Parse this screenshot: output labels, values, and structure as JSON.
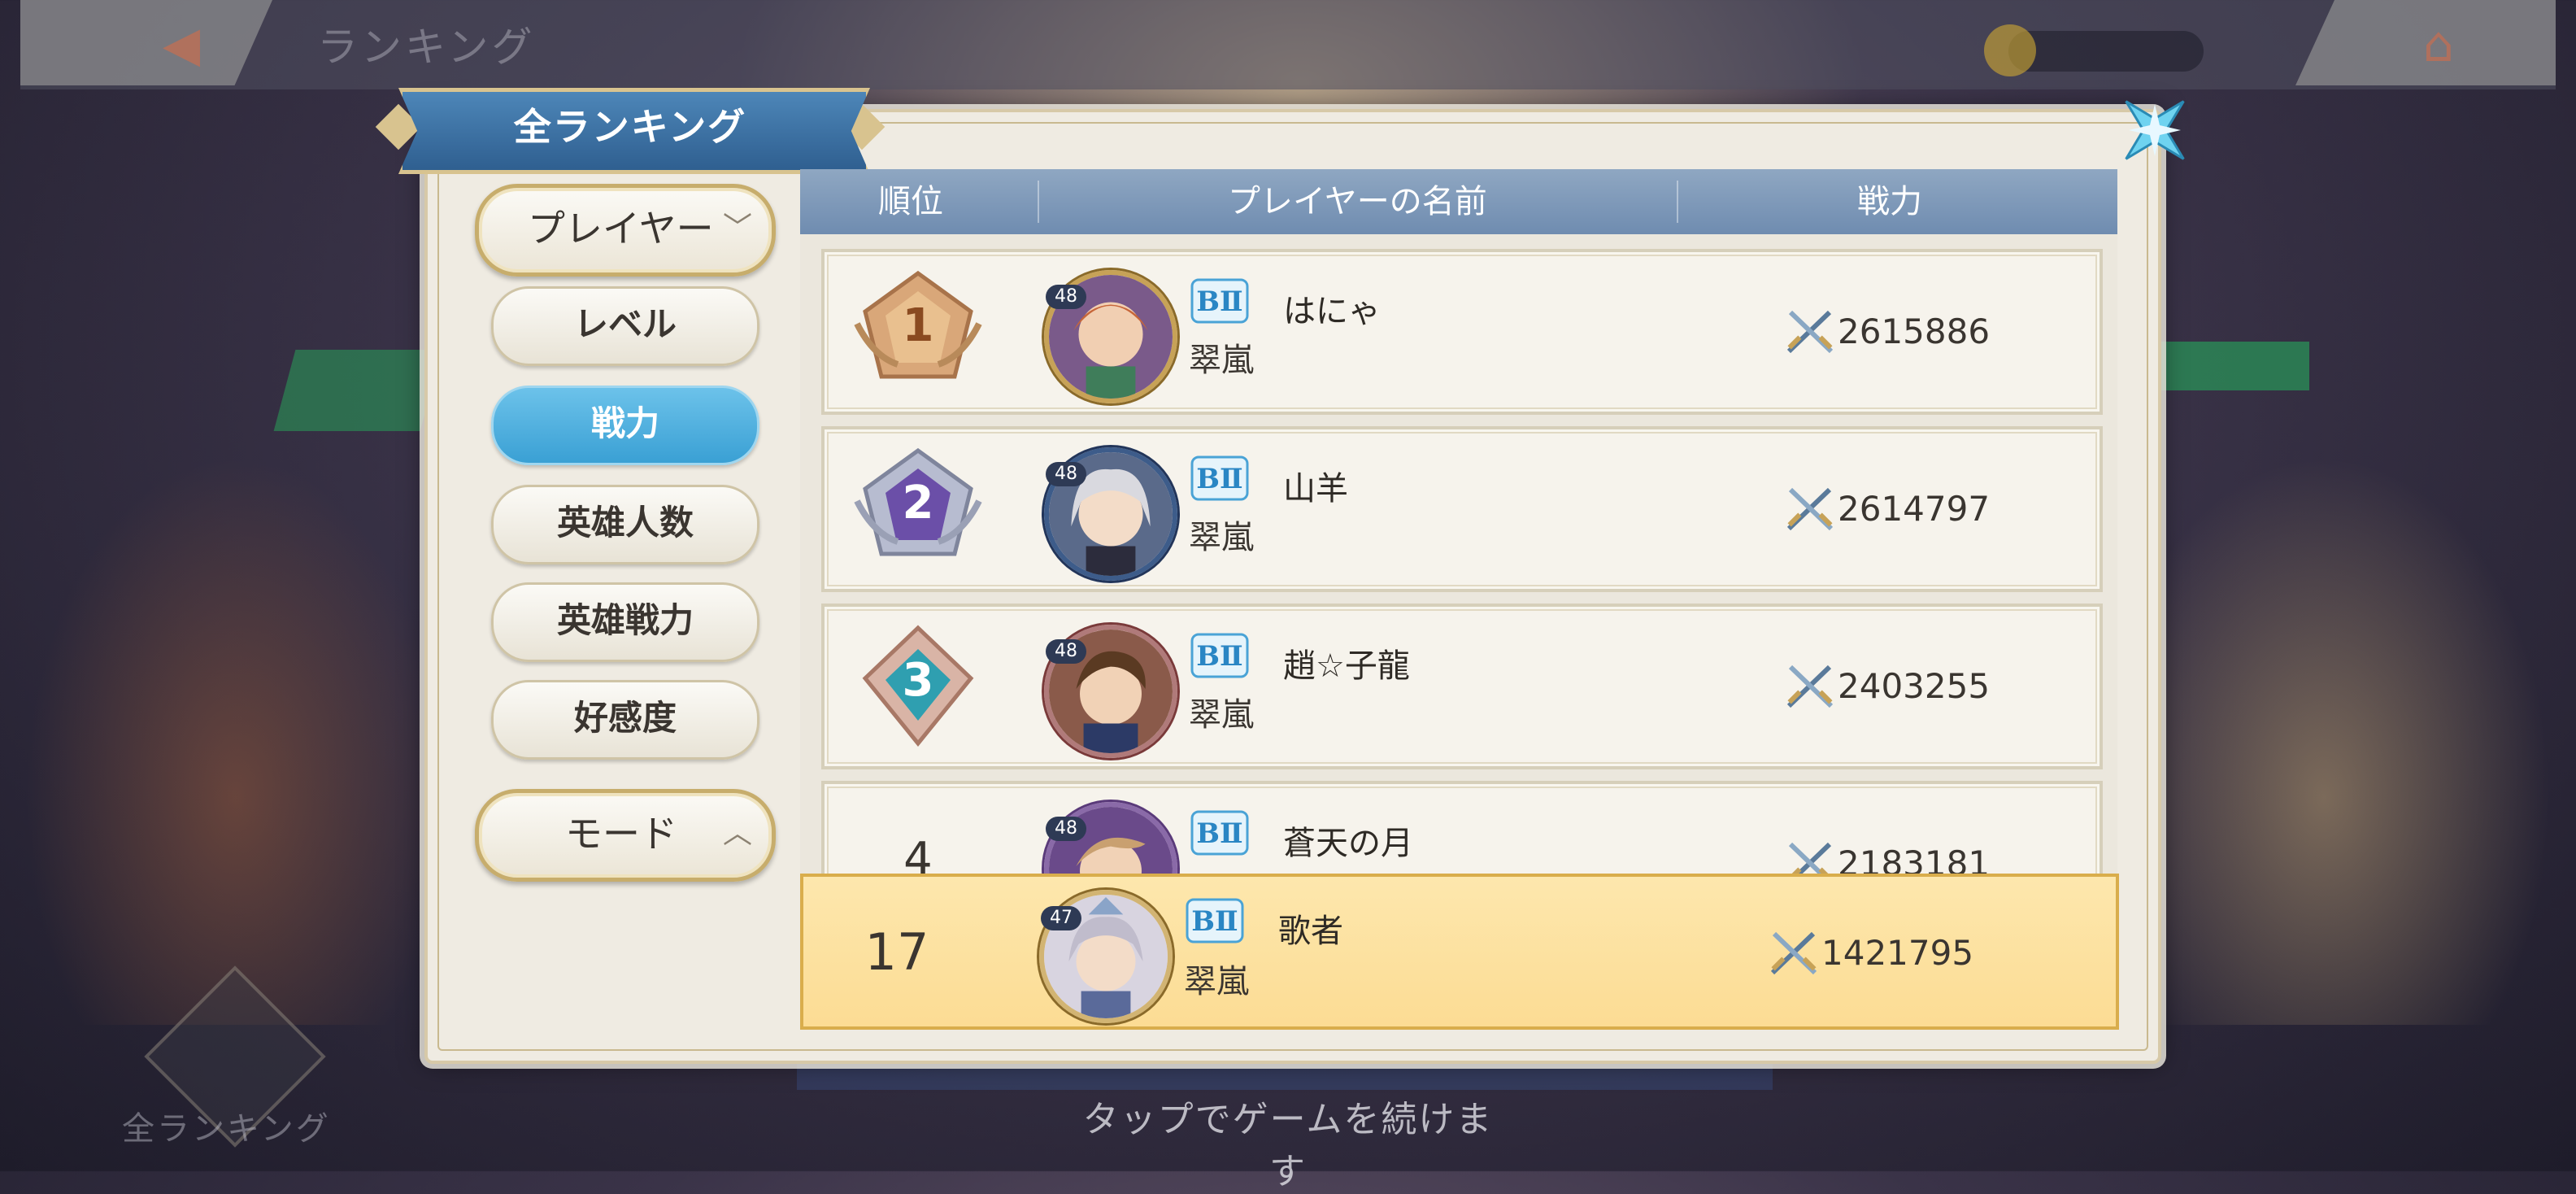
{
  "background": {
    "screen_title": "ランキング",
    "bottom_label": "全ランキング"
  },
  "dialog": {
    "title": "全ランキング"
  },
  "menu": {
    "category_dropdown": "プレイヤー",
    "items": [
      "レベル",
      "戦力",
      "英雄人数",
      "英雄戦力",
      "好感度"
    ],
    "active_item": "戦力",
    "mode_dropdown": "モード"
  },
  "table": {
    "headers": {
      "rank": "順位",
      "name": "プレイヤーの名前",
      "power": "戦力"
    },
    "rows": [
      {
        "rank": "1",
        "level": "48",
        "guild": "翠嵐",
        "name": "はにゃ",
        "power": "2615886"
      },
      {
        "rank": "2",
        "level": "48",
        "guild": "翠嵐",
        "name": "山羊",
        "power": "2614797"
      },
      {
        "rank": "3",
        "level": "48",
        "guild": "翠嵐",
        "name": "趙☆子龍",
        "power": "2403255"
      },
      {
        "rank": "4",
        "level": "48",
        "guild": "",
        "name": "蒼天の月",
        "power": "2183181"
      }
    ]
  },
  "self_row": {
    "rank": "17",
    "level": "47",
    "guild": "翠嵐",
    "name": "歌者",
    "power": "1421795"
  },
  "footer": {
    "tap_text": "タップでゲームを続けます"
  },
  "colors": {
    "accent_blue": "#3aa0d4",
    "self_highlight": "#fde7ad",
    "header_blue": "#7d97b9",
    "gold": "#c7a257"
  },
  "icons": {
    "close": "close-star-icon",
    "power": "crossed-swords-icon",
    "guild_badge": "guild-rank-badge-icon"
  }
}
